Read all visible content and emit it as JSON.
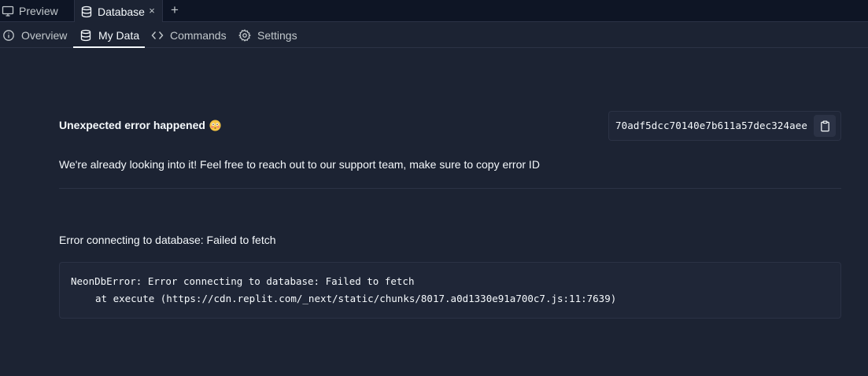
{
  "tabs": {
    "preview_label": "Preview",
    "database_label": "Database",
    "close_glyph": "×",
    "add_glyph": "+"
  },
  "subnav": {
    "overview_label": "Overview",
    "mydata_label": "My Data",
    "commands_label": "Commands",
    "settings_label": "Settings"
  },
  "error": {
    "title": "Unexpected error happened",
    "id": "70adf5dcc70140e7b611a57dec324aee",
    "description": "We're already looking into it! Feel free to reach out to our support team, make sure to copy error ID",
    "message": "Error connecting to database: Failed to fetch",
    "stack": [
      "NeonDbError: Error connecting to database: Failed to fetch",
      "at execute (https://cdn.replit.com/_next/static/chunks/8017.a0d1330e91a700c7.js:11:7639)"
    ]
  },
  "icons": {
    "preview": "monitor-icon",
    "database": "database-icon",
    "overview": "info-icon",
    "mydata": "database-icon",
    "commands": "code-icon",
    "settings": "gear-icon",
    "copy": "clipboard-icon",
    "emoji": "flushed-face-emoji"
  },
  "colors": {
    "background": "#1c2333",
    "tabbar": "#0e1525",
    "border": "#2b3245",
    "text": "#f5f9fc",
    "muted": "#c2c8cc"
  }
}
